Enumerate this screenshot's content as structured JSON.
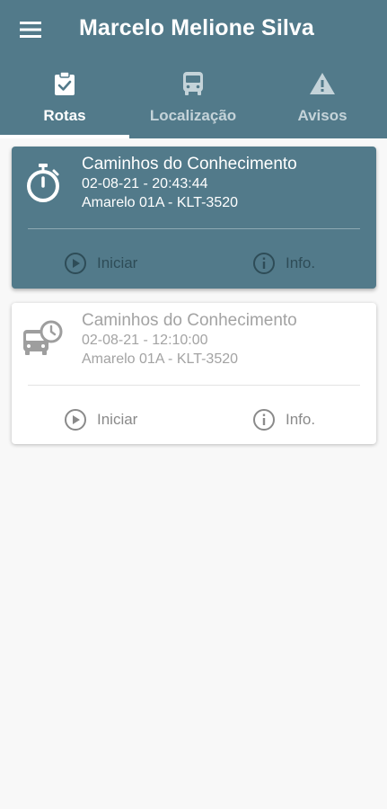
{
  "app": {
    "title": "Marcelo Melione Silva",
    "colors": {
      "primary": "#527a8a",
      "on_primary": "#ffffff",
      "background": "#f8f8f8"
    }
  },
  "tabs": [
    {
      "label": "Rotas",
      "icon": "clipboard-check-icon",
      "active": true
    },
    {
      "label": "Localização",
      "icon": "bus-icon",
      "active": false
    },
    {
      "label": "Avisos",
      "icon": "warning-icon",
      "active": false
    }
  ],
  "routes": [
    {
      "name": "Caminhos do Conhecimento",
      "datetime": "02-08-21 - 20:43:44",
      "bus": "Amarelo 01A - KLT-3520",
      "icon": "stopwatch-icon",
      "state": "active",
      "start_label": "Iniciar",
      "info_label": "Info."
    },
    {
      "name": "Caminhos do Conhecimento",
      "datetime": "02-08-21 - 12:10:00",
      "bus": "Amarelo 01A - KLT-3520",
      "icon": "bus-schedule-icon",
      "state": "idle",
      "start_label": "Iniciar",
      "info_label": "Info."
    }
  ]
}
